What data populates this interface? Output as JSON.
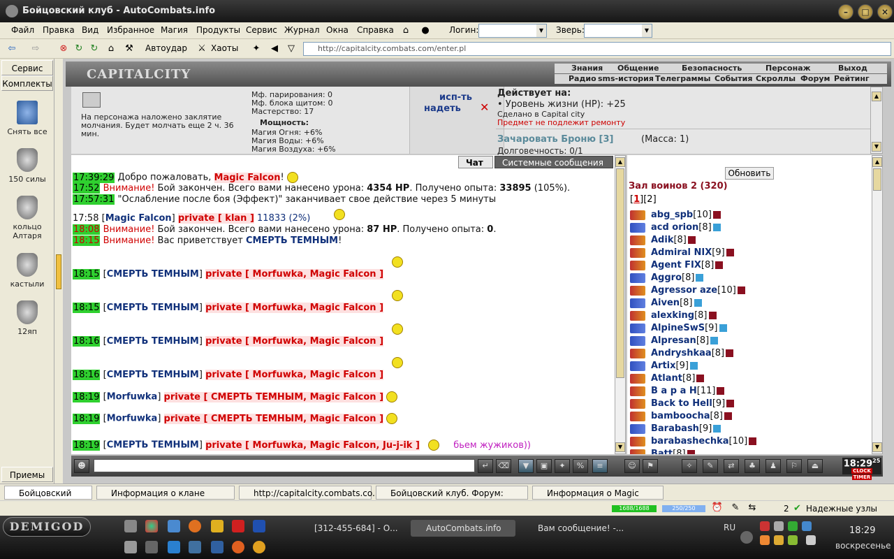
{
  "window": {
    "title": "Бойцовский клуб - AutoCombats.info",
    "min": "–",
    "max": "□",
    "close": "×"
  },
  "menu": {
    "items": [
      "Файл",
      "Правка",
      "Вид",
      "Избранное",
      "Магия",
      "Продукты",
      "Сервис",
      "Журнал",
      "Окна",
      "Справка"
    ],
    "login_label": "Логин:",
    "beast_label": "Зверь:"
  },
  "toolbar": {
    "autoudar": "Автоудар",
    "haoty": "Хаоты",
    "url": "http://capitalcity.combats.com/enter.pl"
  },
  "sidebar": {
    "service": "Сервис",
    "komplekty": "Комплекты",
    "priemy": "Приемы",
    "items": [
      "Снять все",
      "150 силы",
      "кольцо Алтаря",
      "кастыли",
      "12яп"
    ]
  },
  "site": {
    "logo": "CAPITALCITY",
    "nav1": [
      "Знания",
      "Общение",
      "Безопасность",
      "Персонаж",
      "Выход"
    ],
    "nav2": [
      "Радио",
      "sms-история",
      "Телеграммы",
      "События",
      "Скроллы",
      "Форум",
      "Рейтинг"
    ]
  },
  "info": {
    "silence": "На персонажа наложено заклятие молчания. Будет молчать еще 2 ч. 36 мин.",
    "stats": [
      "Мф. парирования: 0",
      "Мф. блока щитом: 0",
      "Мастерство: 17"
    ],
    "power": "Мощность:",
    "magic": [
      "Магия Огня: +6%",
      "Магия Воды: +6%",
      "Магия Воздуха: +6%"
    ],
    "use": "исп-ть",
    "wear": "надеть",
    "acts_on": "Действует на:",
    "hp_bonus": "• Уровень жизни (HP): +25",
    "made_in": "Сделано в Capital city",
    "no_repair": "Предмет не подлежит ремонту",
    "enchant": "Зачаровать Броню [3]",
    "mass": "(Масса: 1)",
    "durability": "Долговечность: 0/1"
  },
  "chat": {
    "tab_chat": "Чат",
    "tab_system": "Системные сообщения",
    "lines": [
      {
        "t": "17:39:29",
        "text": "Добро пожаловать, ",
        "name": "Magic Falcon",
        "end": "!"
      },
      {
        "t": "17:52",
        "w": "Внимание!",
        "text": " Бой закончен. Всего вами нанесено урона: ",
        "dmg": "4354 HP",
        "mid": ". Получено опыта: ",
        "exp": "33895",
        "end": " (105%)."
      },
      {
        "t": "17:57:31",
        "text": "\"Ослабление после боя (Эффект)\" заканчивает свое действие через 5 минуты"
      },
      {
        "t": "17:58",
        "who": "Magic Falcon",
        "priv": "private [ klan ]",
        "text": " 11833 (2%)"
      },
      {
        "t": "18:08",
        "w": "Внимание!",
        "text": " Бой закончен. Всего вами нанесено урона: ",
        "dmg": "87 HP",
        "mid": ". Получено опыта: ",
        "exp": "0",
        "end": "."
      },
      {
        "t": "18:15",
        "w": "Внимание!",
        "text": " Вас приветствует ",
        "name2": "СМЕРТЬ ТЕМНЫМ",
        "end": "!"
      },
      {
        "t": "18:15",
        "who": "СМЕРТЬ ТЕМНЫМ",
        "priv": "private [ Morfuwka, Magic Falcon ]"
      },
      {
        "t": "18:15",
        "who": "СМЕРТЬ ТЕМНЫМ",
        "priv": "private [ Morfuwka, Magic Falcon ]"
      },
      {
        "t": "18:16",
        "who": "СМЕРТЬ ТЕМНЫМ",
        "priv": "private [ Morfuwka, Magic Falcon ]"
      },
      {
        "t": "18:16",
        "who": "СМЕРТЬ ТЕМНЫМ",
        "priv": "private [ Morfuwka, Magic Falcon ]"
      },
      {
        "t": "18:19",
        "who": "Morfuwka",
        "priv": "private [ СМЕРТЬ ТЕМНЫМ, Magic Falcon ]"
      },
      {
        "t": "18:19",
        "who": "Morfuwka",
        "priv": "private [ СМЕРТЬ ТЕМНЫМ, Magic Falcon ]"
      },
      {
        "t": "18:19",
        "who": "СМЕРТЬ ТЕМНЫМ",
        "priv": "private [ Morfuwka, Magic Falcon, Ju-j-ik ]",
        "extra": "бьем жужиков))"
      }
    ]
  },
  "users": {
    "refresh": "Обновить",
    "hall": "Зал воинов 2 (320)",
    "pages": [
      "1",
      "2"
    ],
    "list": [
      {
        "n": "abg_spb",
        "l": "[10]",
        "c": "r"
      },
      {
        "n": "acd orion",
        "l": "[8]",
        "c": "b"
      },
      {
        "n": "Adik",
        "l": "[8]",
        "c": "r"
      },
      {
        "n": "Admiral NIX",
        "l": "[9]",
        "c": "r"
      },
      {
        "n": "Agent FIX",
        "l": "[8]",
        "c": "r"
      },
      {
        "n": "Aggro",
        "l": "[8]",
        "c": "b"
      },
      {
        "n": "Agressor aze",
        "l": "[10]",
        "c": "r"
      },
      {
        "n": "Aiven",
        "l": "[8]",
        "c": "b"
      },
      {
        "n": "alexking",
        "l": "[8]",
        "c": "r"
      },
      {
        "n": "AlpineSwS",
        "l": "[9]",
        "c": "b"
      },
      {
        "n": "Alpresan",
        "l": "[8]",
        "c": "b"
      },
      {
        "n": "Andryshkaa",
        "l": "[8]",
        "c": "r"
      },
      {
        "n": "Artix",
        "l": "[9]",
        "c": "b"
      },
      {
        "n": "Atlant",
        "l": "[8]",
        "c": "r"
      },
      {
        "n": "В а р а Н",
        "l": "[11]",
        "c": "r"
      },
      {
        "n": "Back to Hell",
        "l": "[9]",
        "c": "r"
      },
      {
        "n": "bamboocha",
        "l": "[8]",
        "c": "r"
      },
      {
        "n": "Barabash",
        "l": "[9]",
        "c": "b"
      },
      {
        "n": "barabashechka",
        "l": "[10]",
        "c": "r"
      },
      {
        "n": "Batt",
        "l": "[8]",
        "c": "r"
      }
    ]
  },
  "bottom": {
    "clock": "18:29",
    "clock_sec": "25",
    "clock_label": "CLOCK",
    "timer_label": "TIMER"
  },
  "tabs": [
    "Бойцовский клуб",
    "Информация о клане DarkZenit",
    "http://capitalcity.combats.co...",
    "Бойцовский клуб. Форум: \"Жало...",
    "Информация о Magic Falcon"
  ],
  "status": {
    "hp": "1688/1688",
    "mana": "250/250",
    "nodes_count": "2",
    "nodes": "Надежные узлы"
  },
  "taskbar": {
    "start": "DEMIGOD",
    "tasks": [
      "[312-455-684] - О...",
      "AutoCombats.info",
      "Вам сообщение! -..."
    ],
    "lang": "RU",
    "time": "18:29",
    "day": "воскресенье"
  }
}
